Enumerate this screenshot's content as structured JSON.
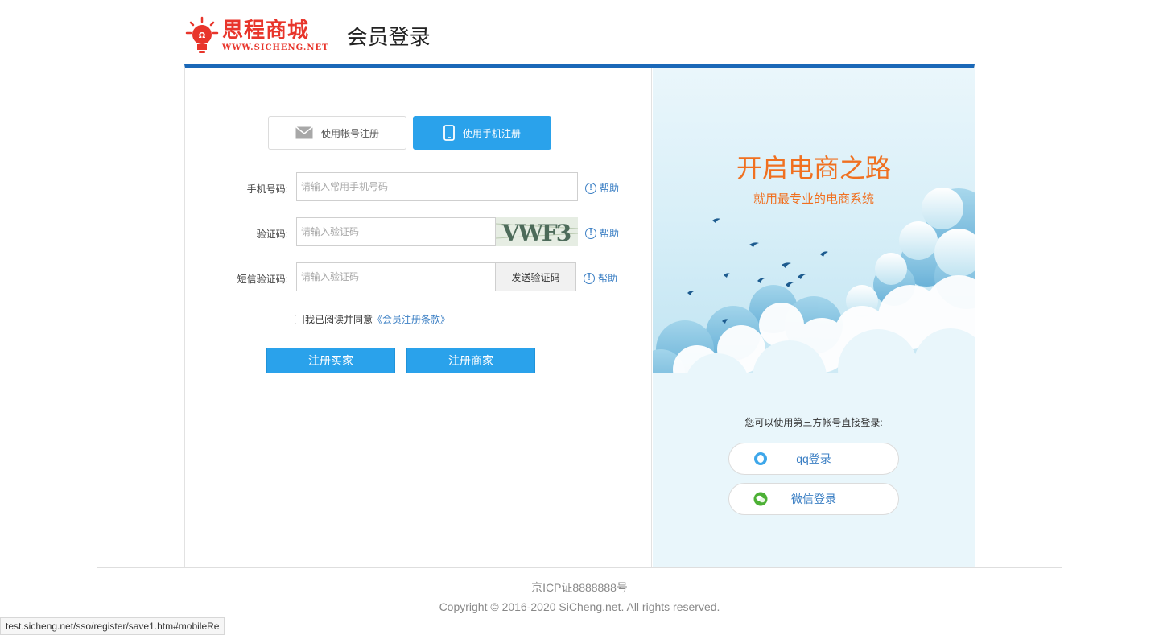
{
  "header": {
    "logo_cn": "思程商城",
    "logo_en": "WWW.SICHENG.NET",
    "title": "会员登录"
  },
  "tabs": [
    {
      "label": "使用帐号注册",
      "active": false
    },
    {
      "label": "使用手机注册",
      "active": true
    }
  ],
  "form": {
    "phone": {
      "label": "手机号码:",
      "placeholder": "请输入常用手机号码",
      "help": "帮助"
    },
    "captcha": {
      "label": "验证码:",
      "placeholder": "请输入验证码",
      "help": "帮助",
      "image_text": "VWF3"
    },
    "sms": {
      "label": "短信验证码:",
      "placeholder": "请输入验证码",
      "button": "发送验证码",
      "help": "帮助"
    },
    "agree_text": "我已阅读并同意",
    "agree_link": "《会员注册条款》",
    "agree_checked": false,
    "register_buyer": "注册买家",
    "register_seller": "注册商家"
  },
  "promo": {
    "slogan": "开启电商之路",
    "sub": "就用最专业的电商系统",
    "third_party_hint": "您可以使用第三方帐号直接登录:",
    "qq_label": "qq登录",
    "wechat_label": "微信登录"
  },
  "footer": {
    "icp": "京ICP证8888888号",
    "copyright": "Copyright © 2016-2020 SiCheng.net. All rights reserved."
  },
  "status_url": "test.sicheng.net/sso/register/save1.htm#mobileRe",
  "colors": {
    "accent": "#2aa2eb",
    "brand_red": "#e8352b",
    "slogan_orange": "#f07020",
    "top_border": "#1a68b8",
    "link": "#3b7fc4"
  }
}
